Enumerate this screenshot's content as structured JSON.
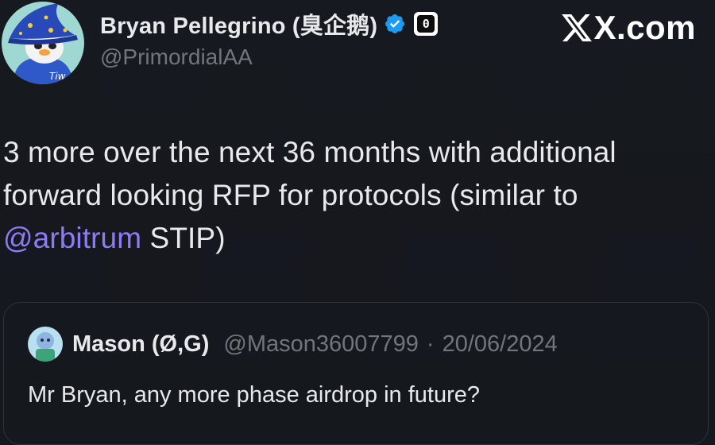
{
  "author": {
    "name": "Bryan Pellegrino (臭企鹅)",
    "handle": "@PrimordialAA",
    "affiliate_badge_text": "0",
    "avatar_icon": "wizard-penguin-avatar"
  },
  "brand": {
    "text": "X.com",
    "logo_icon": "x-logo-icon"
  },
  "tweet": {
    "text_before_mention": "3 more over the next 36 months with additional forward looking RFP for protocols (similar to ",
    "mention": "@arbitrum",
    "text_after_mention": " STIP)"
  },
  "quote": {
    "author_name": "Mason (Ø,G)",
    "author_handle": "@Mason36007799",
    "separator": "·",
    "date": "20/06/2024",
    "text": "Mr Bryan, any more phase airdrop in future?",
    "avatar_icon": "mason-avatar"
  },
  "colors": {
    "background": "#15181e",
    "text_primary": "#e7e9ea",
    "text_secondary": "#71767b",
    "mention": "#8b7cf6",
    "verified": "#1d9bf0",
    "border": "#2f3336"
  }
}
